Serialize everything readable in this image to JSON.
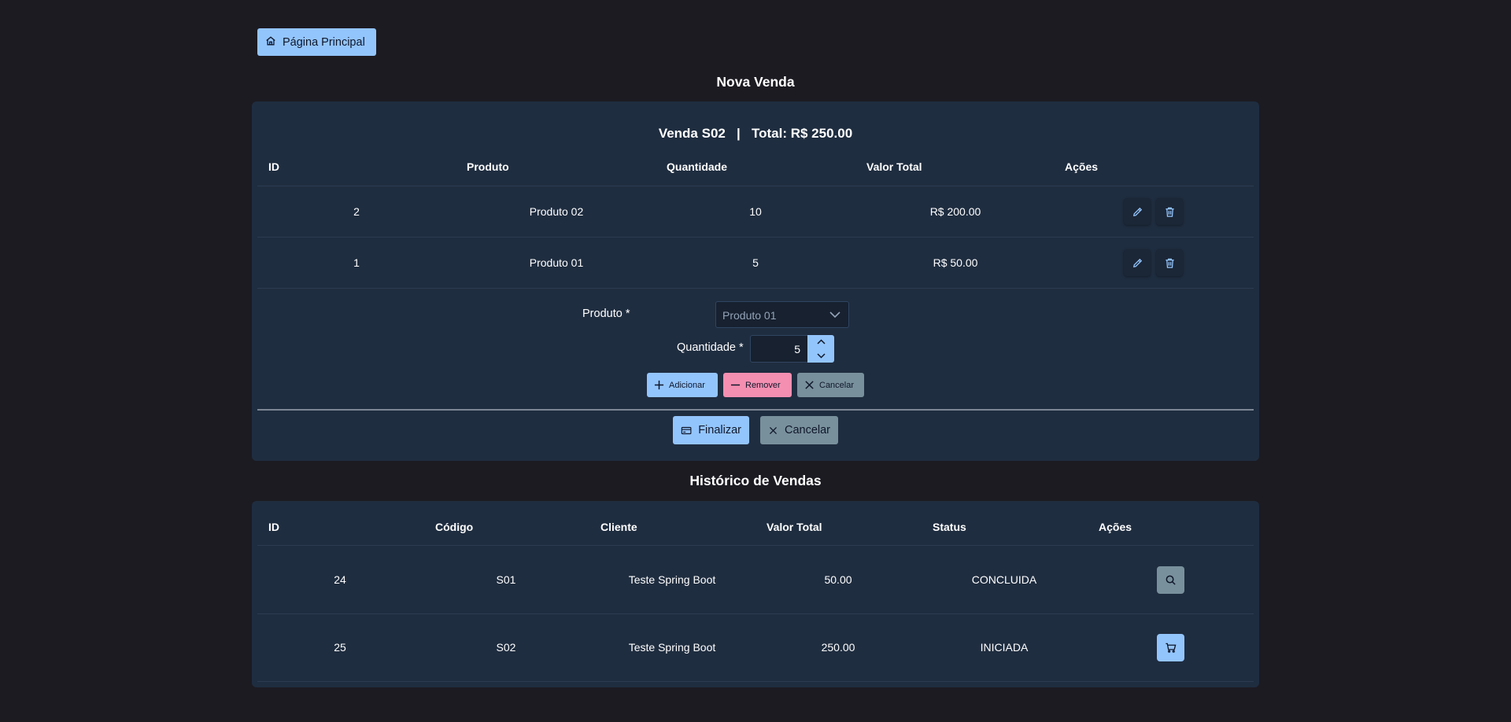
{
  "home": {
    "label": "Página Principal"
  },
  "nova_venda": {
    "title": "Nova Venda",
    "sale_code_label": "Venda S02",
    "separator": "|",
    "total_label": "Total: R$ 250.00",
    "columns": [
      "ID",
      "Produto",
      "Quantidade",
      "Valor Total",
      "Ações"
    ],
    "rows": [
      {
        "id": "2",
        "produto": "Produto 02",
        "quantidade": "10",
        "valor_total": "R$ 200.00"
      },
      {
        "id": "1",
        "produto": "Produto 01",
        "quantidade": "5",
        "valor_total": "R$ 50.00"
      }
    ],
    "form": {
      "produto_label": "Produto",
      "quantidade_label": "Quantidade",
      "required_mark": "*",
      "produto_value": "Produto 01",
      "quantidade_value": "5",
      "add_label": "Adicionar",
      "remove_label": "Remover",
      "cancel_label": "Cancelar"
    },
    "finalizar_label": "Finalizar",
    "cancelar_label": "Cancelar"
  },
  "historico": {
    "title": "Histórico de Vendas",
    "columns": [
      "ID",
      "Código",
      "Cliente",
      "Valor Total",
      "Status",
      "Ações"
    ],
    "rows": [
      {
        "id": "24",
        "codigo": "S01",
        "cliente": "Teste Spring Boot",
        "valor_total": "50.00",
        "status": "CONCLUIDA",
        "action_icon": "search-icon"
      },
      {
        "id": "25",
        "codigo": "S02",
        "cliente": "Teste Spring Boot",
        "valor_total": "250.00",
        "status": "INICIADA",
        "action_icon": "cart-icon"
      }
    ]
  },
  "colors": {
    "background": "#1c1b22",
    "card": "#1f2d40",
    "primary": "#93c5fd",
    "danger": "#f48fb1",
    "secondary": "#78909c"
  }
}
